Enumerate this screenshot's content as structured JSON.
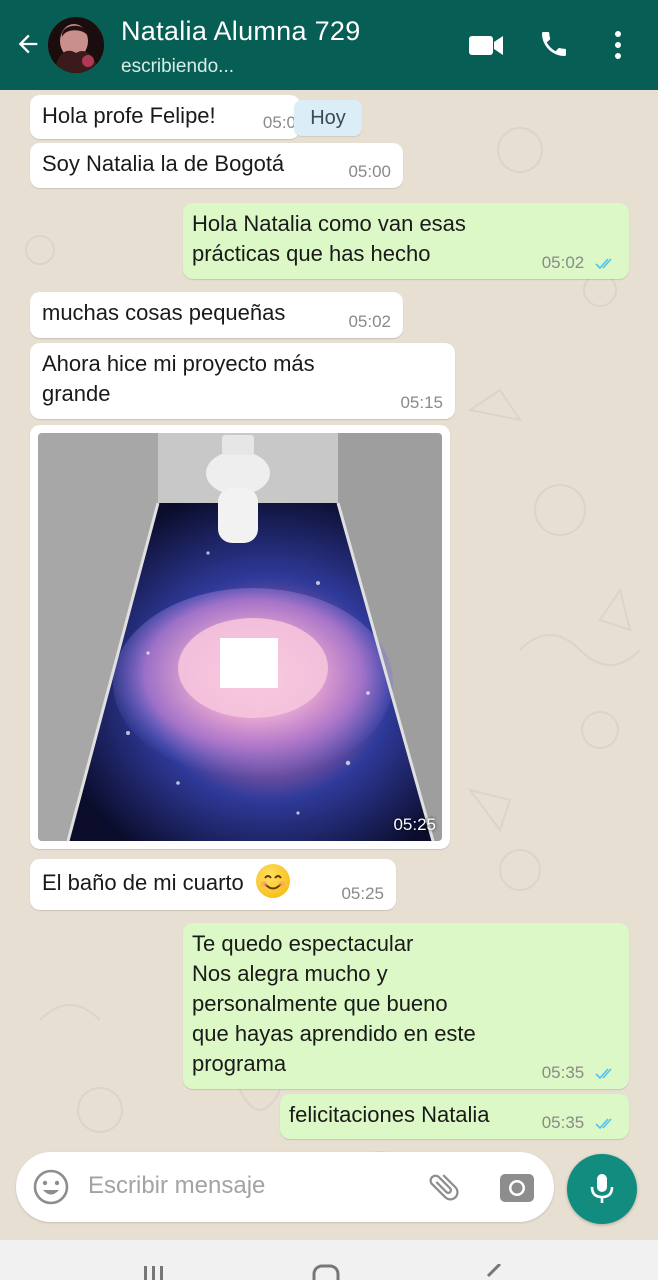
{
  "header": {
    "contact_name": "Natalia Alumna 729",
    "status": "escribiendo...",
    "bg_color": "#075e54"
  },
  "chat": {
    "date_chip": "Hoy",
    "messages": [
      {
        "dir": "in",
        "text": "Hola profe Felipe!",
        "time": "05:0"
      },
      {
        "dir": "in",
        "text": "Soy Natalia la de Bogotá",
        "time": "05:00"
      },
      {
        "dir": "out",
        "lines": [
          "Hola Natalia  como van esas",
          "prácticas que has hecho"
        ],
        "time": "05:02",
        "read": true
      },
      {
        "dir": "in",
        "text": "muchas cosas pequeñas",
        "time": "05:02"
      },
      {
        "dir": "in",
        "lines": [
          "Ahora hice mi proyecto más",
          "grande"
        ],
        "time": "05:15"
      },
      {
        "dir": "in",
        "type": "image",
        "image_desc_icon": "photo-3d-floor",
        "time": "05:25"
      },
      {
        "dir": "in",
        "text": "El baño de mi cuarto",
        "emoji": "smiling-face-icon",
        "time": "05:25"
      },
      {
        "dir": "out",
        "lines": [
          "Te quedo espectacular",
          "Nos alegra mucho y",
          "personalmente  que bueno",
          "que hayas aprendido en este",
          "programa"
        ],
        "time": "05:35",
        "read": true
      },
      {
        "dir": "out",
        "text": "felicitaciones Natalia",
        "time": "05:35",
        "read": true
      }
    ],
    "incoming_color": "#ffffff",
    "outgoing_color": "#dcf8c6",
    "read_tick_color": "#4fc3f7"
  },
  "composer": {
    "placeholder": "Escribir mensaje",
    "accent": "#128c7e"
  }
}
